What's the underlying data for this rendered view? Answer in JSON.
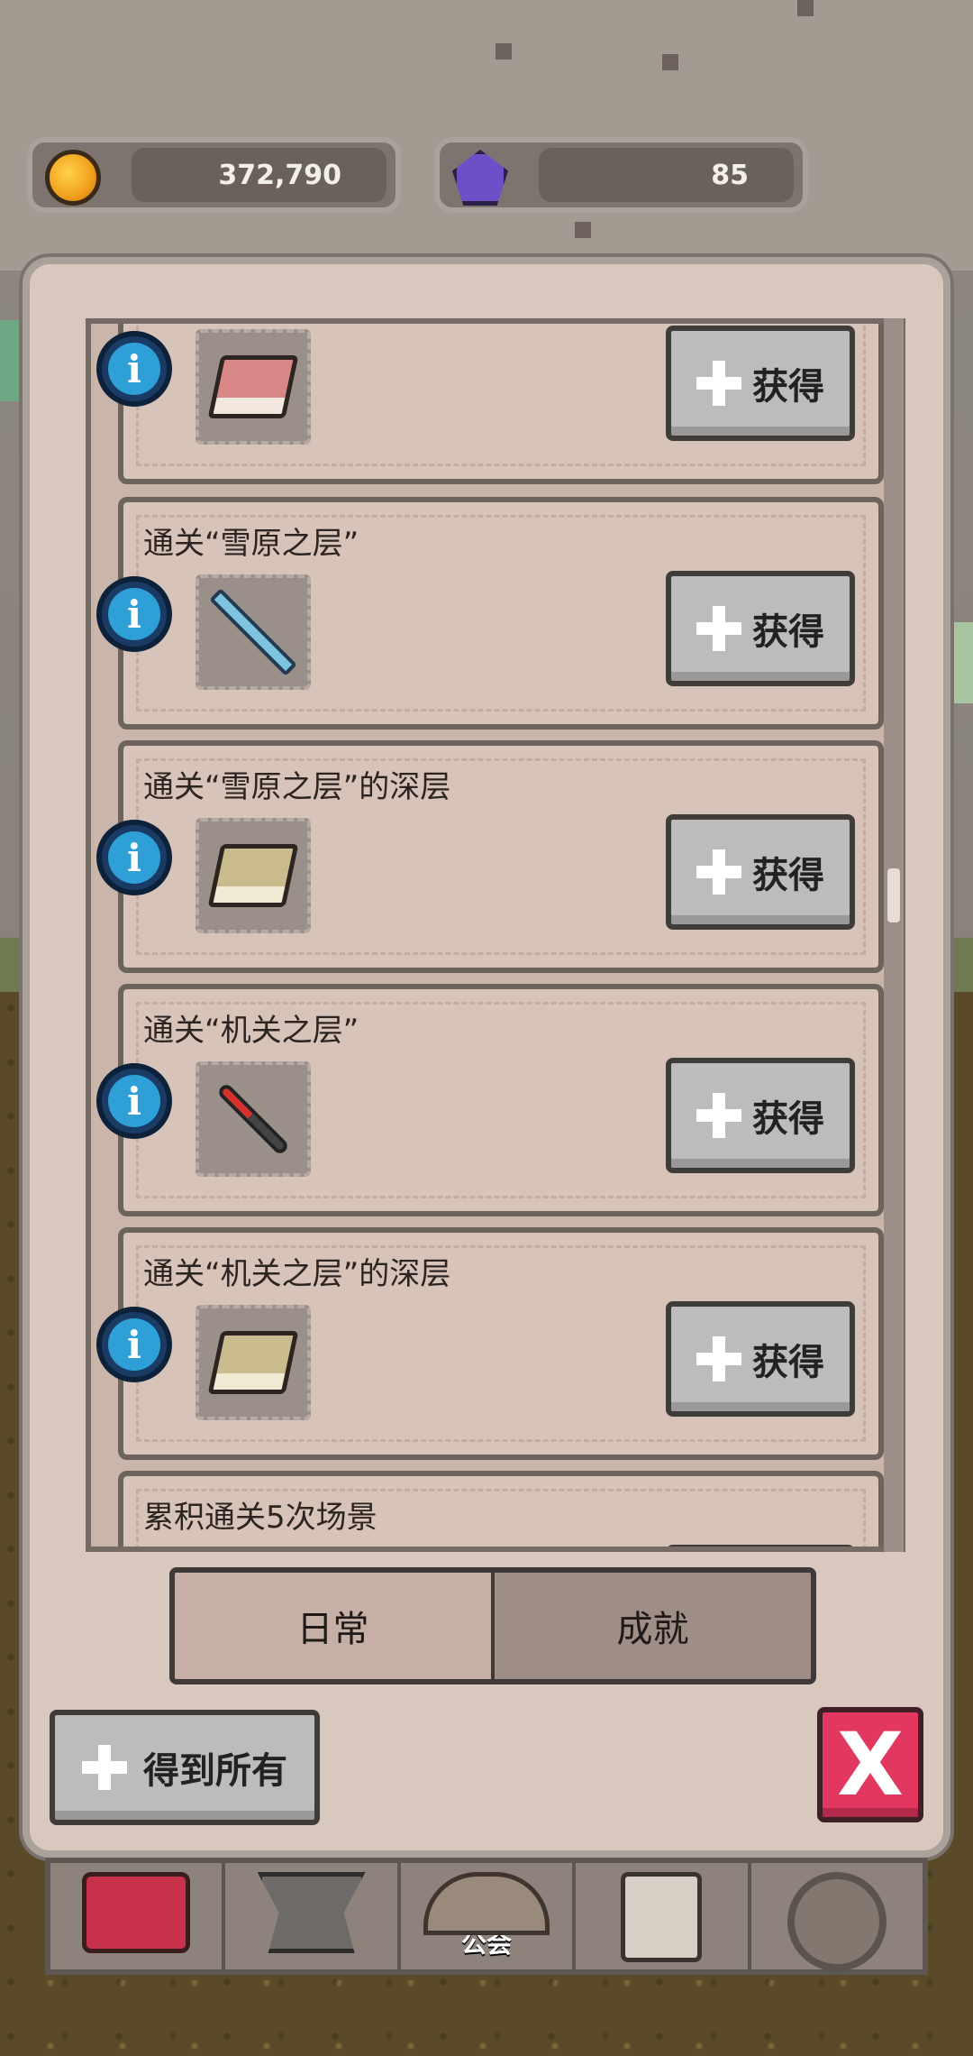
{
  "currency": {
    "gold": "372,790",
    "gems": "85",
    "gold_icon": "gold-coin-icon",
    "gem_icon": "purple-gem-icon"
  },
  "quests": [
    {
      "title": "",
      "reward": "red-book-icon",
      "button": "获得"
    },
    {
      "title": "通关“雪原之层”",
      "reward": "ice-sword-icon",
      "button": "获得"
    },
    {
      "title": "通关“雪原之层”的深层",
      "reward": "tan-book-icon",
      "button": "获得"
    },
    {
      "title": "通关“机关之层”",
      "reward": "red-dagger-icon",
      "button": "获得"
    },
    {
      "title": "通关“机关之层”的深层",
      "reward": "tan-book-icon",
      "button": "获得"
    },
    {
      "title": "累积通关5次场景",
      "reward": "",
      "button": ""
    }
  ],
  "tabs": {
    "daily": "日常",
    "achievements": "成就"
  },
  "actions": {
    "get_all": "得到所有",
    "close": "X"
  },
  "bottom_nav": {
    "guild": "公会"
  },
  "colors": {
    "panel": "#d9c8bd",
    "close_button": "#e2375f",
    "info_blue": "#2f9fd8"
  }
}
